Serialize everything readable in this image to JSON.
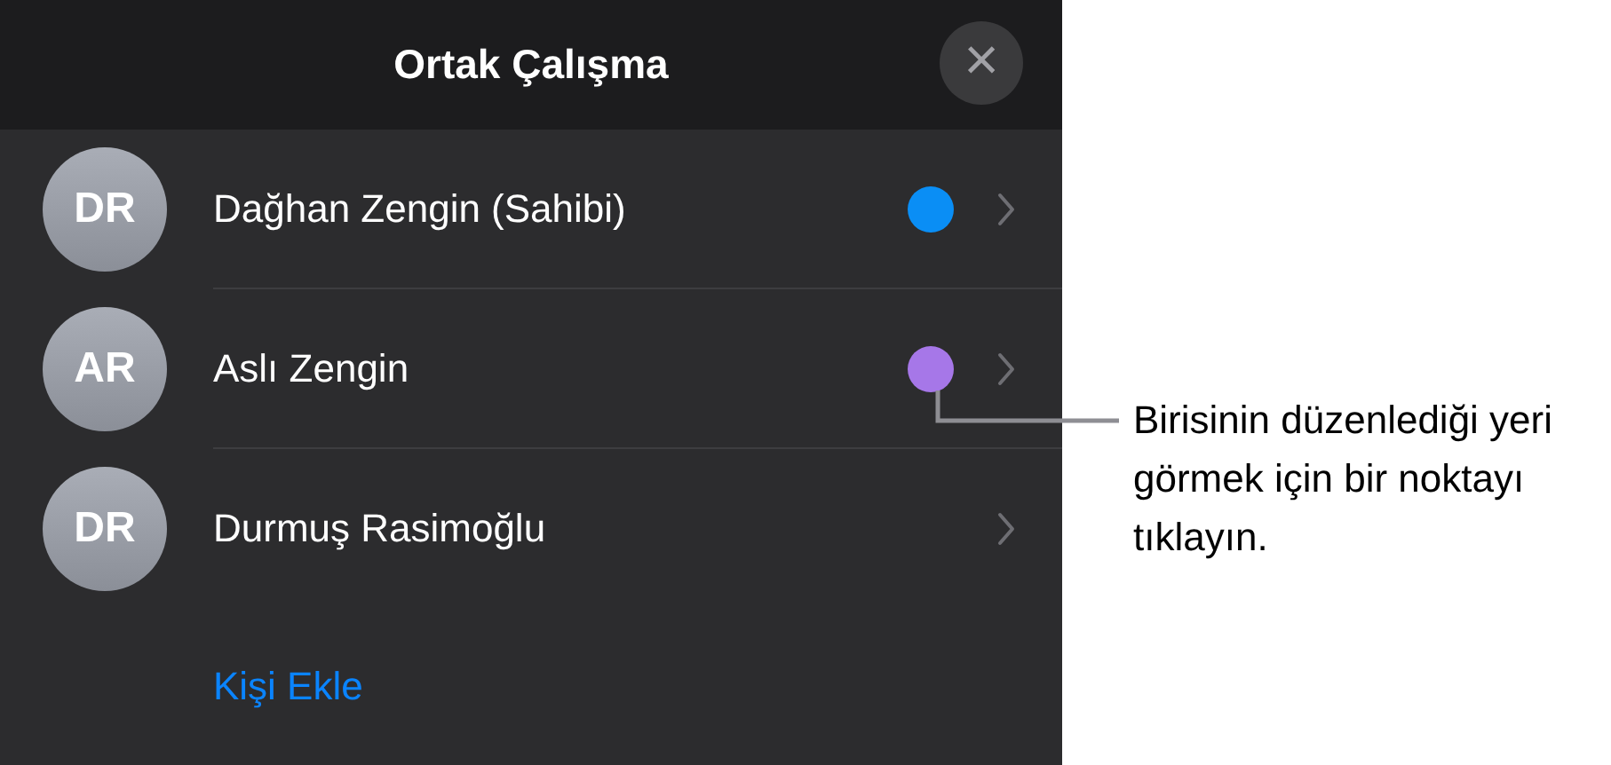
{
  "panel": {
    "title": "Ortak Çalışma",
    "close": "×",
    "participants": [
      {
        "initials": "DR",
        "name": "Dağhan Zengin (Sahibi)",
        "color": "#0a8ef5"
      },
      {
        "initials": "AR",
        "name": "Aslı Zengin",
        "color": "#a677e8"
      },
      {
        "initials": "DR",
        "name": "Durmuş Rasimoğlu"
      }
    ],
    "add_person": "Kişi Ekle"
  },
  "callout": "Birisinin düzenlediği yeri görmek için bir noktayı tıklayın."
}
